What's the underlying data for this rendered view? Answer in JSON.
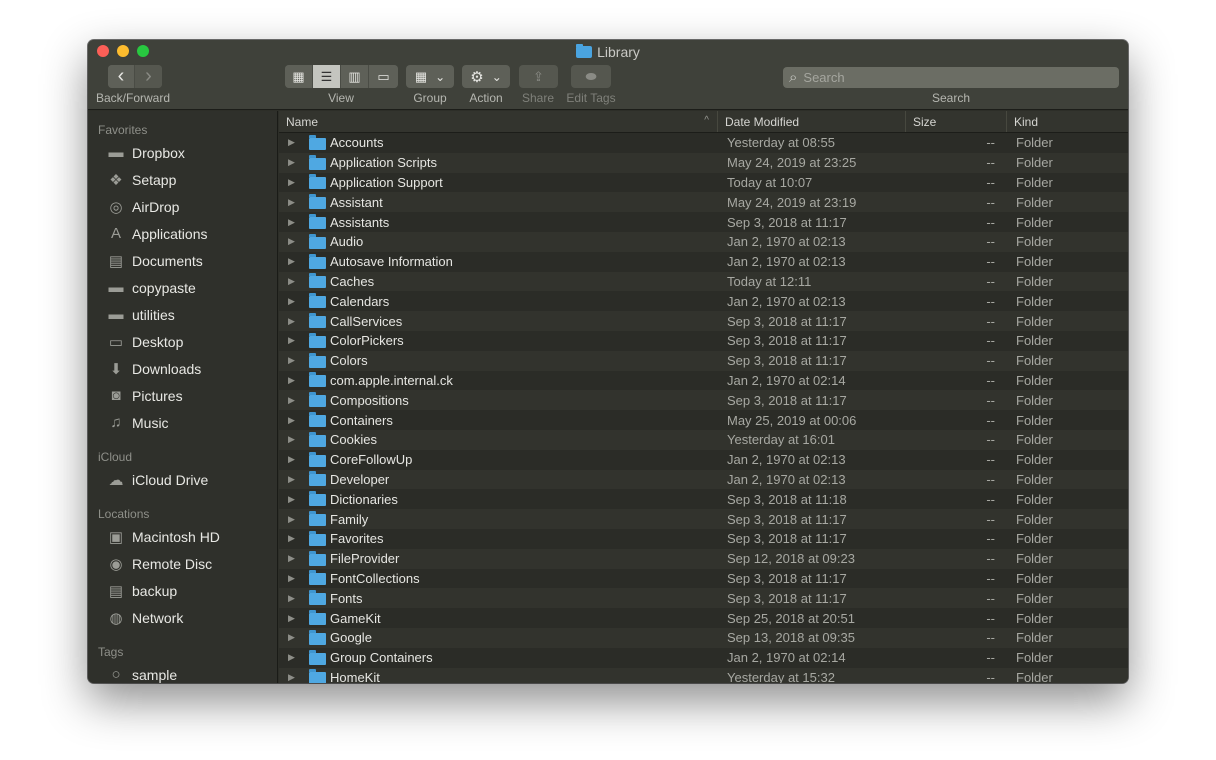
{
  "window": {
    "title": "Library",
    "traffic_lights": {
      "close": "#fc5f57",
      "minimize": "#fdbc2e",
      "maximize": "#28c840"
    }
  },
  "toolbar": {
    "back_forward_label": "Back/Forward",
    "back_icon": "‹",
    "forward_icon": "›",
    "view_label": "View",
    "view_modes": [
      {
        "name": "icon-view",
        "glyph": "▦",
        "active": false
      },
      {
        "name": "list-view",
        "glyph": "☰",
        "active": true
      },
      {
        "name": "column-view",
        "glyph": "▥",
        "active": false
      },
      {
        "name": "gallery-view",
        "glyph": "▭",
        "active": false
      }
    ],
    "group_label": "Group",
    "group_glyph": "▦",
    "action_label": "Action",
    "action_glyph": "⚙",
    "share_label": "Share",
    "share_glyph": "⇪",
    "edit_tags_label": "Edit Tags",
    "edit_tags_glyph": "⬬",
    "chevron_glyph": "⌄",
    "search_placeholder": "Search",
    "search_label": "Search",
    "search_glyph": "⌕"
  },
  "sidebar": {
    "favorites_heading": "Favorites",
    "favorites": [
      {
        "label": "Dropbox",
        "icon": "folder-icon",
        "glyph": "▬"
      },
      {
        "label": "Setapp",
        "icon": "setapp-icon",
        "glyph": "❖"
      },
      {
        "label": "AirDrop",
        "icon": "airdrop-icon",
        "glyph": "◎"
      },
      {
        "label": "Applications",
        "icon": "applications-icon",
        "glyph": "A"
      },
      {
        "label": "Documents",
        "icon": "documents-icon",
        "glyph": "▤"
      },
      {
        "label": "copypaste",
        "icon": "folder-icon",
        "glyph": "▬"
      },
      {
        "label": "utilities",
        "icon": "folder-icon",
        "glyph": "▬"
      },
      {
        "label": "Desktop",
        "icon": "desktop-icon",
        "glyph": "▭"
      },
      {
        "label": "Downloads",
        "icon": "downloads-icon",
        "glyph": "⬇"
      },
      {
        "label": "Pictures",
        "icon": "camera-icon",
        "glyph": "◙"
      },
      {
        "label": "Music",
        "icon": "music-icon",
        "glyph": "♫"
      }
    ],
    "icloud_heading": "iCloud",
    "icloud": [
      {
        "label": "iCloud Drive",
        "icon": "cloud-icon",
        "glyph": "☁"
      }
    ],
    "locations_heading": "Locations",
    "locations": [
      {
        "label": "Macintosh HD",
        "icon": "hard-drive-icon",
        "glyph": "▣"
      },
      {
        "label": "Remote Disc",
        "icon": "disc-icon",
        "glyph": "◉"
      },
      {
        "label": "backup",
        "icon": "external-drive-icon",
        "glyph": "▤"
      },
      {
        "label": "Network",
        "icon": "network-icon",
        "glyph": "◍"
      }
    ],
    "tags_heading": "Tags",
    "tags": [
      {
        "label": "sample",
        "icon": "tag-circle-icon",
        "glyph": "○"
      }
    ]
  },
  "list": {
    "columns": {
      "name": "Name",
      "date": "Date Modified",
      "size": "Size",
      "kind": "Kind"
    },
    "sort_indicator": "^",
    "rows": [
      {
        "name": "Accounts",
        "date": "Yesterday at 08:55",
        "size": "--",
        "kind": "Folder"
      },
      {
        "name": "Application Scripts",
        "date": "May 24, 2019 at 23:25",
        "size": "--",
        "kind": "Folder"
      },
      {
        "name": "Application Support",
        "date": "Today at 10:07",
        "size": "--",
        "kind": "Folder"
      },
      {
        "name": "Assistant",
        "date": "May 24, 2019 at 23:19",
        "size": "--",
        "kind": "Folder"
      },
      {
        "name": "Assistants",
        "date": "Sep 3, 2018 at 11:17",
        "size": "--",
        "kind": "Folder"
      },
      {
        "name": "Audio",
        "date": "Jan 2, 1970 at 02:13",
        "size": "--",
        "kind": "Folder"
      },
      {
        "name": "Autosave Information",
        "date": "Jan 2, 1970 at 02:13",
        "size": "--",
        "kind": "Folder"
      },
      {
        "name": "Caches",
        "date": "Today at 12:11",
        "size": "--",
        "kind": "Folder"
      },
      {
        "name": "Calendars",
        "date": "Jan 2, 1970 at 02:13",
        "size": "--",
        "kind": "Folder"
      },
      {
        "name": "CallServices",
        "date": "Sep 3, 2018 at 11:17",
        "size": "--",
        "kind": "Folder"
      },
      {
        "name": "ColorPickers",
        "date": "Sep 3, 2018 at 11:17",
        "size": "--",
        "kind": "Folder"
      },
      {
        "name": "Colors",
        "date": "Sep 3, 2018 at 11:17",
        "size": "--",
        "kind": "Folder"
      },
      {
        "name": "com.apple.internal.ck",
        "date": "Jan 2, 1970 at 02:14",
        "size": "--",
        "kind": "Folder"
      },
      {
        "name": "Compositions",
        "date": "Sep 3, 2018 at 11:17",
        "size": "--",
        "kind": "Folder"
      },
      {
        "name": "Containers",
        "date": "May 25, 2019 at 00:06",
        "size": "--",
        "kind": "Folder"
      },
      {
        "name": "Cookies",
        "date": "Yesterday at 16:01",
        "size": "--",
        "kind": "Folder"
      },
      {
        "name": "CoreFollowUp",
        "date": "Jan 2, 1970 at 02:13",
        "size": "--",
        "kind": "Folder"
      },
      {
        "name": "Developer",
        "date": "Jan 2, 1970 at 02:13",
        "size": "--",
        "kind": "Folder"
      },
      {
        "name": "Dictionaries",
        "date": "Sep 3, 2018 at 11:18",
        "size": "--",
        "kind": "Folder"
      },
      {
        "name": "Family",
        "date": "Sep 3, 2018 at 11:17",
        "size": "--",
        "kind": "Folder"
      },
      {
        "name": "Favorites",
        "date": "Sep 3, 2018 at 11:17",
        "size": "--",
        "kind": "Folder"
      },
      {
        "name": "FileProvider",
        "date": "Sep 12, 2018 at 09:23",
        "size": "--",
        "kind": "Folder"
      },
      {
        "name": "FontCollections",
        "date": "Sep 3, 2018 at 11:17",
        "size": "--",
        "kind": "Folder"
      },
      {
        "name": "Fonts",
        "date": "Sep 3, 2018 at 11:17",
        "size": "--",
        "kind": "Folder"
      },
      {
        "name": "GameKit",
        "date": "Sep 25, 2018 at 20:51",
        "size": "--",
        "kind": "Folder"
      },
      {
        "name": "Google",
        "date": "Sep 13, 2018 at 09:35",
        "size": "--",
        "kind": "Folder"
      },
      {
        "name": "Group Containers",
        "date": "Jan 2, 1970 at 02:14",
        "size": "--",
        "kind": "Folder"
      },
      {
        "name": "HomeKit",
        "date": "Yesterday at 15:32",
        "size": "--",
        "kind": "Folder"
      }
    ]
  }
}
